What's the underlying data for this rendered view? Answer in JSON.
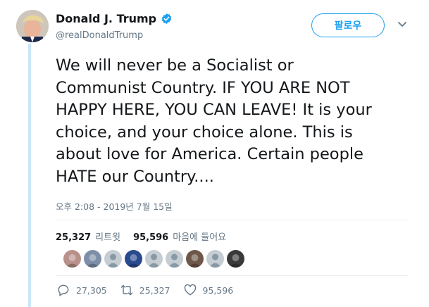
{
  "tweet": {
    "display_name": "Donald J. Trump",
    "handle": "@realDonaldTrump",
    "verified_icon": "verified-badge-icon",
    "follow_label": "팔로우",
    "text": "We will never be a Socialist or\nCommunist Country. IF YOU ARE NOT\nHAPPY HERE, YOU CAN LEAVE! It is your\nchoice, and your choice alone. This is\nabout love for America. Certain people\nHATE our Country....",
    "timestamp": "오후 2:08 - 2019년 7월 15일"
  },
  "stats": {
    "retweets_count": "25,327",
    "retweets_label": "리트윗",
    "likes_count": "95,596",
    "likes_label": "마음에 들어요"
  },
  "likers": [
    {
      "kind": "photo",
      "color": "#b9918a"
    },
    {
      "kind": "photo",
      "color": "#7d8fa8"
    },
    {
      "kind": "default",
      "color": "#c5cdd3"
    },
    {
      "kind": "photo",
      "color": "#2a4a8f"
    },
    {
      "kind": "default",
      "color": "#c5cdd3"
    },
    {
      "kind": "default",
      "color": "#c5cdd3"
    },
    {
      "kind": "photo",
      "color": "#6e5648"
    },
    {
      "kind": "default",
      "color": "#c5cdd3"
    },
    {
      "kind": "photo",
      "color": "#3a3a3a"
    }
  ],
  "actions": {
    "replies": "27,305",
    "retweets": "25,327",
    "likes": "95,596"
  },
  "colors": {
    "accent": "#1da1f2",
    "muted": "#657786",
    "thread_line": "#cbe6f6"
  }
}
